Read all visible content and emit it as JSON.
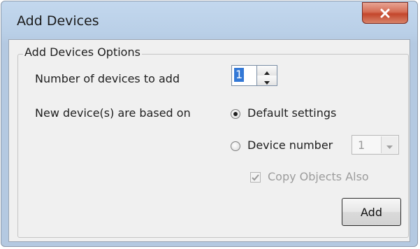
{
  "window": {
    "title": "Add Devices"
  },
  "group": {
    "legend": "Add Devices Options"
  },
  "fields": {
    "num_devices_label": "Number of devices to add",
    "num_devices_value": "1",
    "based_on_label": "New device(s) are based on",
    "option_default": "Default settings",
    "option_default_selected": true,
    "option_device_number": "Device number",
    "option_device_number_selected": false,
    "device_number_value": "1",
    "copy_objects_label": "Copy Objects Also",
    "copy_objects_checked": true,
    "copy_objects_enabled": false
  },
  "buttons": {
    "add": "Add"
  },
  "icons": {
    "close": "close-icon",
    "spin_up": "arrow-up-icon",
    "spin_down": "arrow-down-icon",
    "dropdown": "chevron-down-icon",
    "check": "checkmark-icon"
  },
  "colors": {
    "close_button": "#c3462b",
    "selection": "#3378d6",
    "disabled_text": "#9c9c9c"
  }
}
